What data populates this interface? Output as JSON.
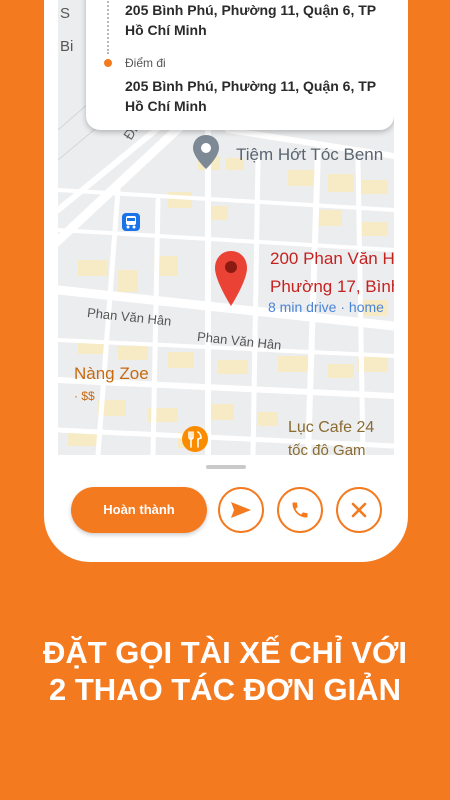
{
  "route": {
    "origin_address": "205 Bình Phú, Phường 11, Quận 6, TP Hồ Chí Minh",
    "destination_label": "Điểm đi",
    "destination_address": "205 Bình Phú, Phường 11, Quận 6, TP Hồ Chí Minh"
  },
  "map": {
    "poi_name": "Tiệm Hớt Tóc Benn",
    "destination_line1": "200 Phan Văn H",
    "destination_line2": "Phường 17, Bình",
    "drive_info": "8 min drive · home",
    "street_1": "Phan Văn Hân",
    "street_2": "Phan Văn Hân",
    "poi_2": "Nàng Zoe",
    "poi_2_price": "· $$",
    "poi_3": "Lục Cafe 24",
    "poi_3_sub": "tốc độ Gam",
    "road_diag": "Điện",
    "edge_1": "S",
    "edge_2": "Bi"
  },
  "actions": {
    "complete_label": "Hoàn thành"
  },
  "headline": {
    "line1": "ĐẶT GỌI TÀI XẾ CHỈ VỚI",
    "line2": "2 THAO TÁC ĐƠN GIẢN"
  },
  "colors": {
    "brand": "#F47A20",
    "map_pin": "#EA4335",
    "poi_icon": "#FB8C00"
  },
  "icons": [
    "map-pin-icon",
    "poi-marker-icon",
    "bus-stop-icon",
    "restaurant-icon",
    "send-icon",
    "phone-icon",
    "close-icon"
  ]
}
